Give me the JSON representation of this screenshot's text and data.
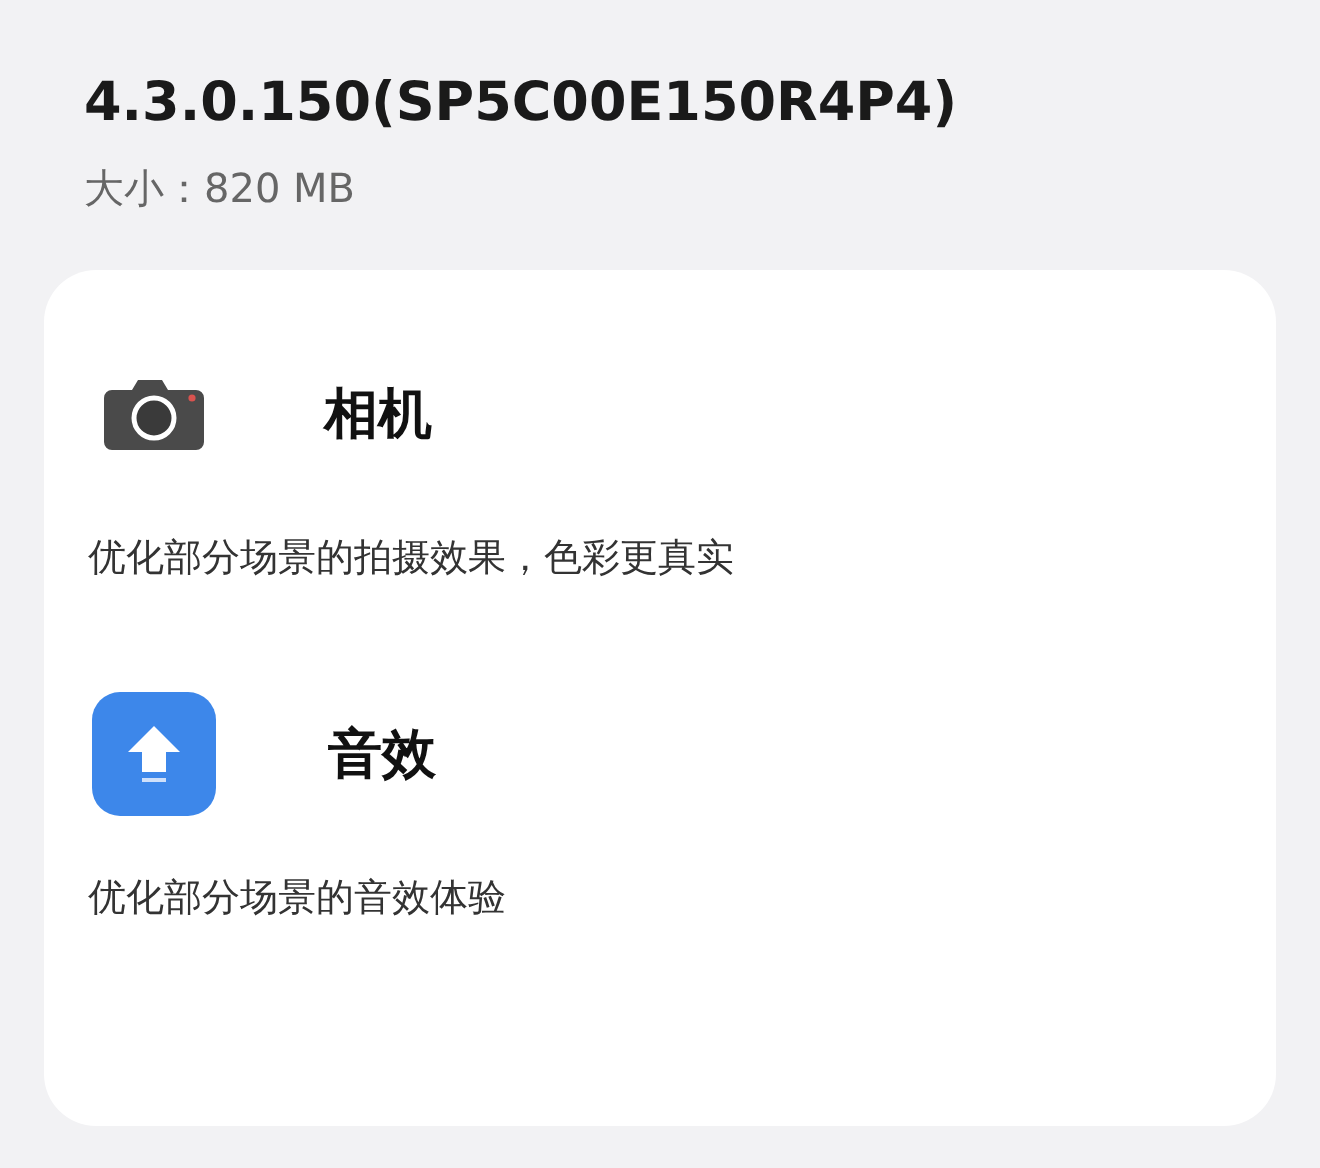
{
  "version": "4.3.0.150(SP5C00E150R4P4)",
  "size": "大小：820 MB",
  "items": [
    {
      "kind": "camera",
      "title": "相机",
      "description": "优化部分场景的拍摄效果，色彩更真实"
    },
    {
      "kind": "sound",
      "title": "音效",
      "description": "优化部分场景的音效体验"
    }
  ]
}
